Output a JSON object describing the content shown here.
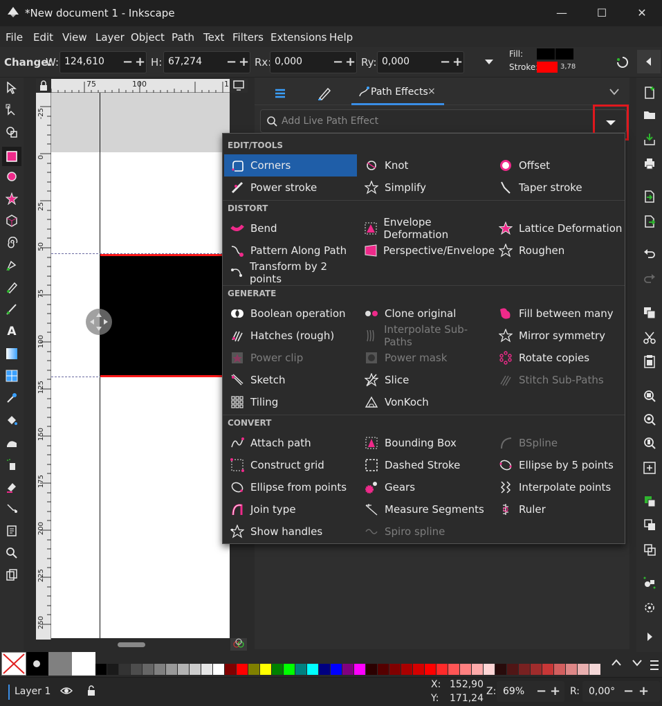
{
  "window": {
    "title": "*New document 1 - Inkscape",
    "minimize_icon": "minimize-icon",
    "maximize_icon": "maximize-icon",
    "close_icon": "close-icon"
  },
  "menu": [
    "File",
    "Edit",
    "View",
    "Layer",
    "Object",
    "Path",
    "Text",
    "Filters",
    "Extensions",
    "Help"
  ],
  "toolbar": {
    "change_label": "Change:",
    "w_label": "W:",
    "w_value": "124,610",
    "h_label": "H:",
    "h_value": "67,274",
    "rx_label": "Rx:",
    "rx_value": "0,000",
    "ry_label": "Ry:",
    "ry_value": "0,000",
    "minus": "−",
    "plus": "+",
    "fill_label": "Fill:",
    "stroke_label": "Stroke:",
    "stroke_width": "3,78",
    "fill_color": "#000000",
    "stroke_color": "#ff0000"
  },
  "ruler": {
    "top_ticks": [
      "75",
      "100",
      "1"
    ],
    "left_ticks": [
      "-25",
      "0",
      "25",
      "50",
      "75",
      "100",
      "125",
      "150",
      "175",
      "200",
      "225",
      "250"
    ]
  },
  "dock": {
    "tab_layers_icon": "layers-icon",
    "tab_fillstroke_icon": "fill-stroke-icon",
    "tab_active_label": "Path Effects",
    "tab_close": "×",
    "search_placeholder": "Add Live Path Effect"
  },
  "lpe": {
    "sections": [
      {
        "title": "EDIT/TOOLS",
        "items": [
          {
            "label": "Corners",
            "enabled": true,
            "selected": true,
            "icon": "corners-icon"
          },
          {
            "label": "Knot",
            "enabled": true,
            "icon": "knot-icon"
          },
          {
            "label": "Offset",
            "enabled": true,
            "icon": "offset-icon"
          },
          {
            "label": "Power stroke",
            "enabled": true,
            "icon": "power-stroke-icon"
          },
          {
            "label": "Simplify",
            "enabled": true,
            "icon": "simplify-icon"
          },
          {
            "label": "Taper stroke",
            "enabled": true,
            "icon": "taper-stroke-icon"
          }
        ]
      },
      {
        "title": "DISTORT",
        "items": [
          {
            "label": "Bend",
            "enabled": true,
            "icon": "bend-icon"
          },
          {
            "label": "Envelope Deformation",
            "enabled": true,
            "icon": "envelope-icon"
          },
          {
            "label": "Lattice Deformation",
            "enabled": true,
            "icon": "lattice-icon"
          },
          {
            "label": "Pattern Along Path",
            "enabled": true,
            "icon": "pattern-path-icon"
          },
          {
            "label": "Perspective/Envelope",
            "enabled": true,
            "icon": "perspective-icon"
          },
          {
            "label": "Roughen",
            "enabled": true,
            "icon": "roughen-icon"
          },
          {
            "label": "Transform by 2 points",
            "enabled": true,
            "icon": "transform-2pts-icon"
          }
        ]
      },
      {
        "title": "GENERATE",
        "items": [
          {
            "label": "Boolean operation",
            "enabled": true,
            "icon": "boolean-icon"
          },
          {
            "label": "Clone original",
            "enabled": true,
            "icon": "clone-original-icon"
          },
          {
            "label": "Fill between many",
            "enabled": true,
            "icon": "fill-between-icon"
          },
          {
            "label": "Hatches (rough)",
            "enabled": true,
            "icon": "hatches-icon"
          },
          {
            "label": "Interpolate Sub-Paths",
            "enabled": false,
            "icon": "interpolate-subpaths-icon"
          },
          {
            "label": "Mirror symmetry",
            "enabled": true,
            "icon": "mirror-icon"
          },
          {
            "label": "Power clip",
            "enabled": false,
            "icon": "power-clip-icon"
          },
          {
            "label": "Power mask",
            "enabled": false,
            "icon": "power-mask-icon"
          },
          {
            "label": "Rotate copies",
            "enabled": true,
            "icon": "rotate-copies-icon"
          },
          {
            "label": "Sketch",
            "enabled": true,
            "icon": "sketch-icon"
          },
          {
            "label": "Slice",
            "enabled": true,
            "icon": "slice-icon"
          },
          {
            "label": "Stitch Sub-Paths",
            "enabled": false,
            "icon": "stitch-icon"
          },
          {
            "label": "Tiling",
            "enabled": true,
            "icon": "tiling-icon"
          },
          {
            "label": "VonKoch",
            "enabled": true,
            "icon": "vonkoch-icon"
          }
        ]
      },
      {
        "title": "CONVERT",
        "items": [
          {
            "label": "Attach path",
            "enabled": true,
            "icon": "attach-path-icon"
          },
          {
            "label": "Bounding Box",
            "enabled": true,
            "icon": "bounding-box-icon"
          },
          {
            "label": "BSpline",
            "enabled": false,
            "icon": "bspline-icon"
          },
          {
            "label": "Construct grid",
            "enabled": true,
            "icon": "construct-grid-icon"
          },
          {
            "label": "Dashed Stroke",
            "enabled": true,
            "icon": "dashed-stroke-icon"
          },
          {
            "label": "Ellipse by 5 points",
            "enabled": true,
            "icon": "ellipse-5-icon"
          },
          {
            "label": "Ellipse from points",
            "enabled": true,
            "icon": "ellipse-points-icon"
          },
          {
            "label": "Gears",
            "enabled": true,
            "icon": "gears-icon"
          },
          {
            "label": "Interpolate points",
            "enabled": true,
            "icon": "interpolate-points-icon"
          },
          {
            "label": "Join type",
            "enabled": true,
            "icon": "join-type-icon"
          },
          {
            "label": "Measure Segments",
            "enabled": true,
            "icon": "measure-icon"
          },
          {
            "label": "Ruler",
            "enabled": true,
            "icon": "ruler-icon"
          },
          {
            "label": "Show handles",
            "enabled": true,
            "icon": "show-handles-icon"
          },
          {
            "label": "Spiro spline",
            "enabled": false,
            "icon": "spiro-icon"
          }
        ]
      }
    ]
  },
  "palette": {
    "swatches": [
      "#000000",
      "#1a1a1a",
      "#333333",
      "#4d4d4d",
      "#666666",
      "#808080",
      "#999999",
      "#b3b3b3",
      "#cccccc",
      "#e6e6e6",
      "#ffffff",
      "#800000",
      "#ff0000",
      "#808000",
      "#ffff00",
      "#008000",
      "#00ff00",
      "#008080",
      "#00ffff",
      "#000080",
      "#0000ff",
      "#800080",
      "#ff00ff",
      "#2b0000",
      "#550000",
      "#800000",
      "#aa0000",
      "#d40000",
      "#ff0000",
      "#ff2a2a",
      "#ff5555",
      "#ff8080",
      "#ffaaaa",
      "#ffd5d5",
      "#280b0b",
      "#501616",
      "#782121",
      "#a02c2c",
      "#c83737",
      "#d35f5f",
      "#de8787",
      "#e9afaf",
      "#f4d7d7"
    ]
  },
  "status": {
    "layer_label": "Layer 1",
    "x_label": "X:",
    "x_value": "152,90",
    "y_label": "Y:",
    "y_value": "171,24",
    "z_label": "Z:",
    "zoom_value": "69%",
    "r_label": "R:",
    "rotation_value": "0,00°"
  }
}
